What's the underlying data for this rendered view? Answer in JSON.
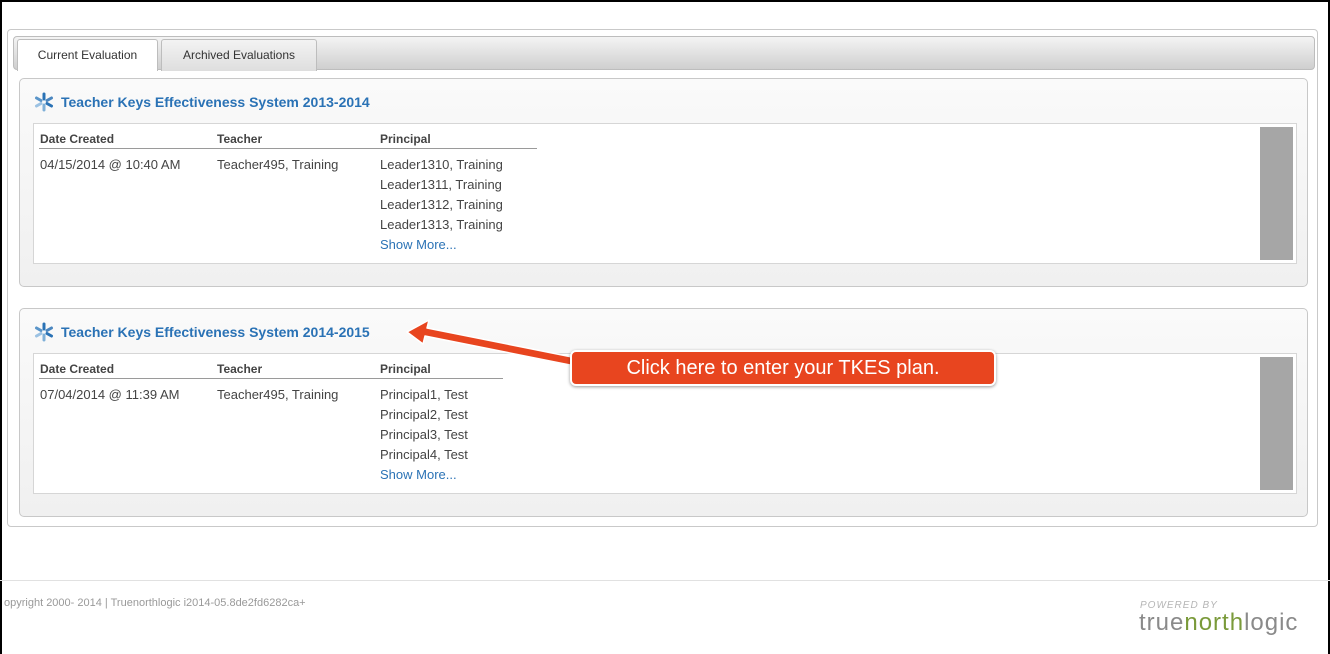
{
  "tabs": [
    {
      "label": "Current Evaluation"
    },
    {
      "label": "Archived Evaluations"
    }
  ],
  "columns": {
    "date": "Date Created",
    "teacher": "Teacher",
    "principal": "Principal"
  },
  "evaluations": [
    {
      "title": "Teacher Keys Effectiveness System 2013-2014",
      "date_created": "04/15/2014 @ 10:40 AM",
      "teacher": "Teacher495, Training",
      "principals": [
        "Leader1310, Training",
        "Leader1311, Training",
        "Leader1312, Training",
        "Leader1313, Training"
      ],
      "show_more": "Show More..."
    },
    {
      "title": "Teacher Keys Effectiveness System 2014-2015",
      "date_created": "07/04/2014 @ 11:39 AM",
      "teacher": "Teacher495, Training",
      "principals": [
        "Principal1, Test",
        "Principal2, Test",
        "Principal3, Test",
        "Principal4, Test"
      ],
      "show_more": "Show More..."
    }
  ],
  "callout": {
    "text": "Click here to enter your TKES plan."
  },
  "footer": {
    "copyright": "opyright 2000- 2014 | Truenorthlogic   i2014-05.8de2fd6282ca+",
    "powered_by": "POWERED BY",
    "brand_part1": "true",
    "brand_part2": "north",
    "brand_part3": "logic"
  },
  "colors": {
    "link": "#2a72b5",
    "callout_bg": "#e8451f",
    "brand_accent": "#7a9a3a"
  }
}
